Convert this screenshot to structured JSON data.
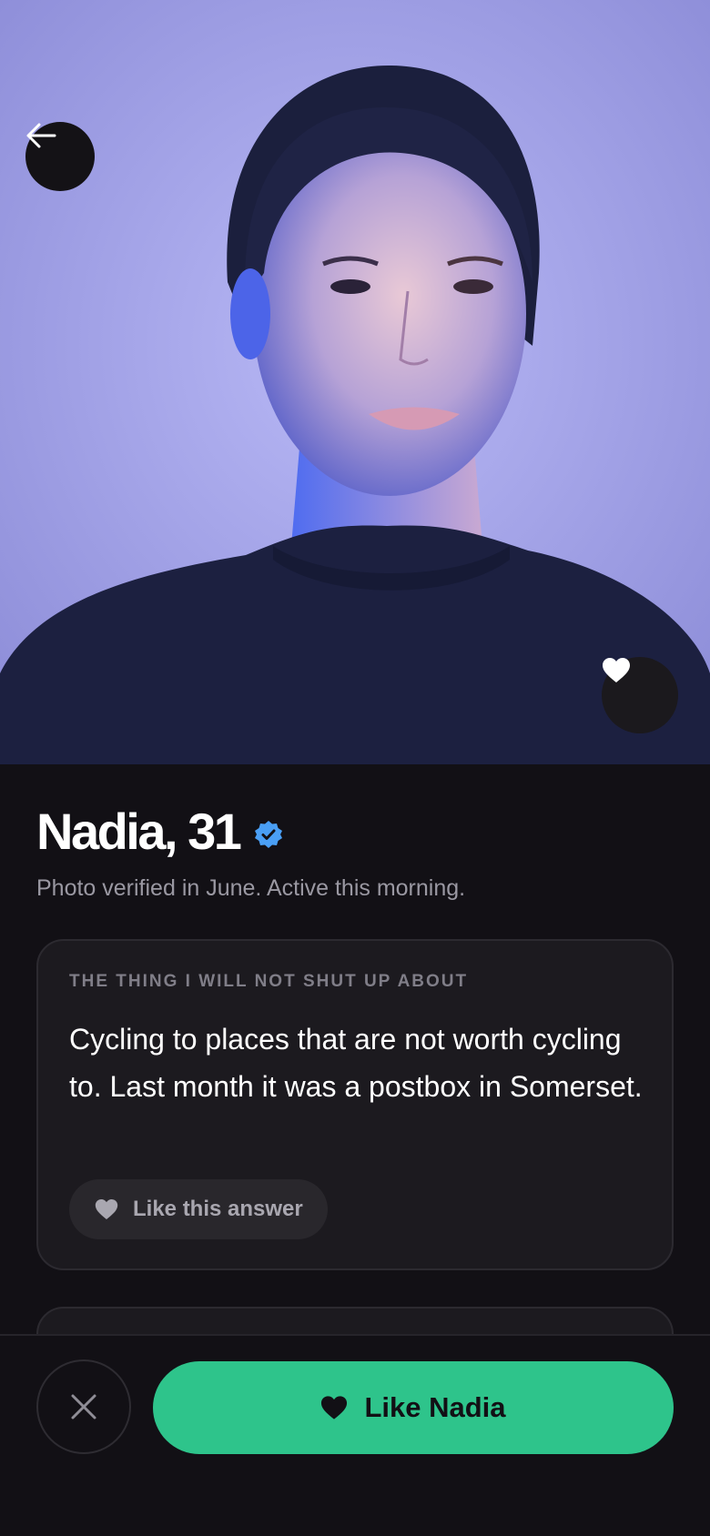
{
  "profile": {
    "name_age": "Nadia, 31",
    "status": "Photo verified in June. Active this morning.",
    "verified_badge": "verified-badge-icon"
  },
  "prompt": {
    "label": "THE THING I WILL NOT SHUT UP ABOUT",
    "answer": "Cycling to places that are not worth cycling to. Last month it was a postbox in Somerset.",
    "like_label": "Like this answer"
  },
  "actions": {
    "back_icon": "arrow-left-icon",
    "photo_like_icon": "heart-icon",
    "pass_icon": "close-icon",
    "like_label": "Like Nadia"
  },
  "colors": {
    "background": "#121015",
    "card": "#1c1a1f",
    "accent": "#2ec48b",
    "verified": "#4a9ff5",
    "muted_text": "#9a98a2"
  }
}
